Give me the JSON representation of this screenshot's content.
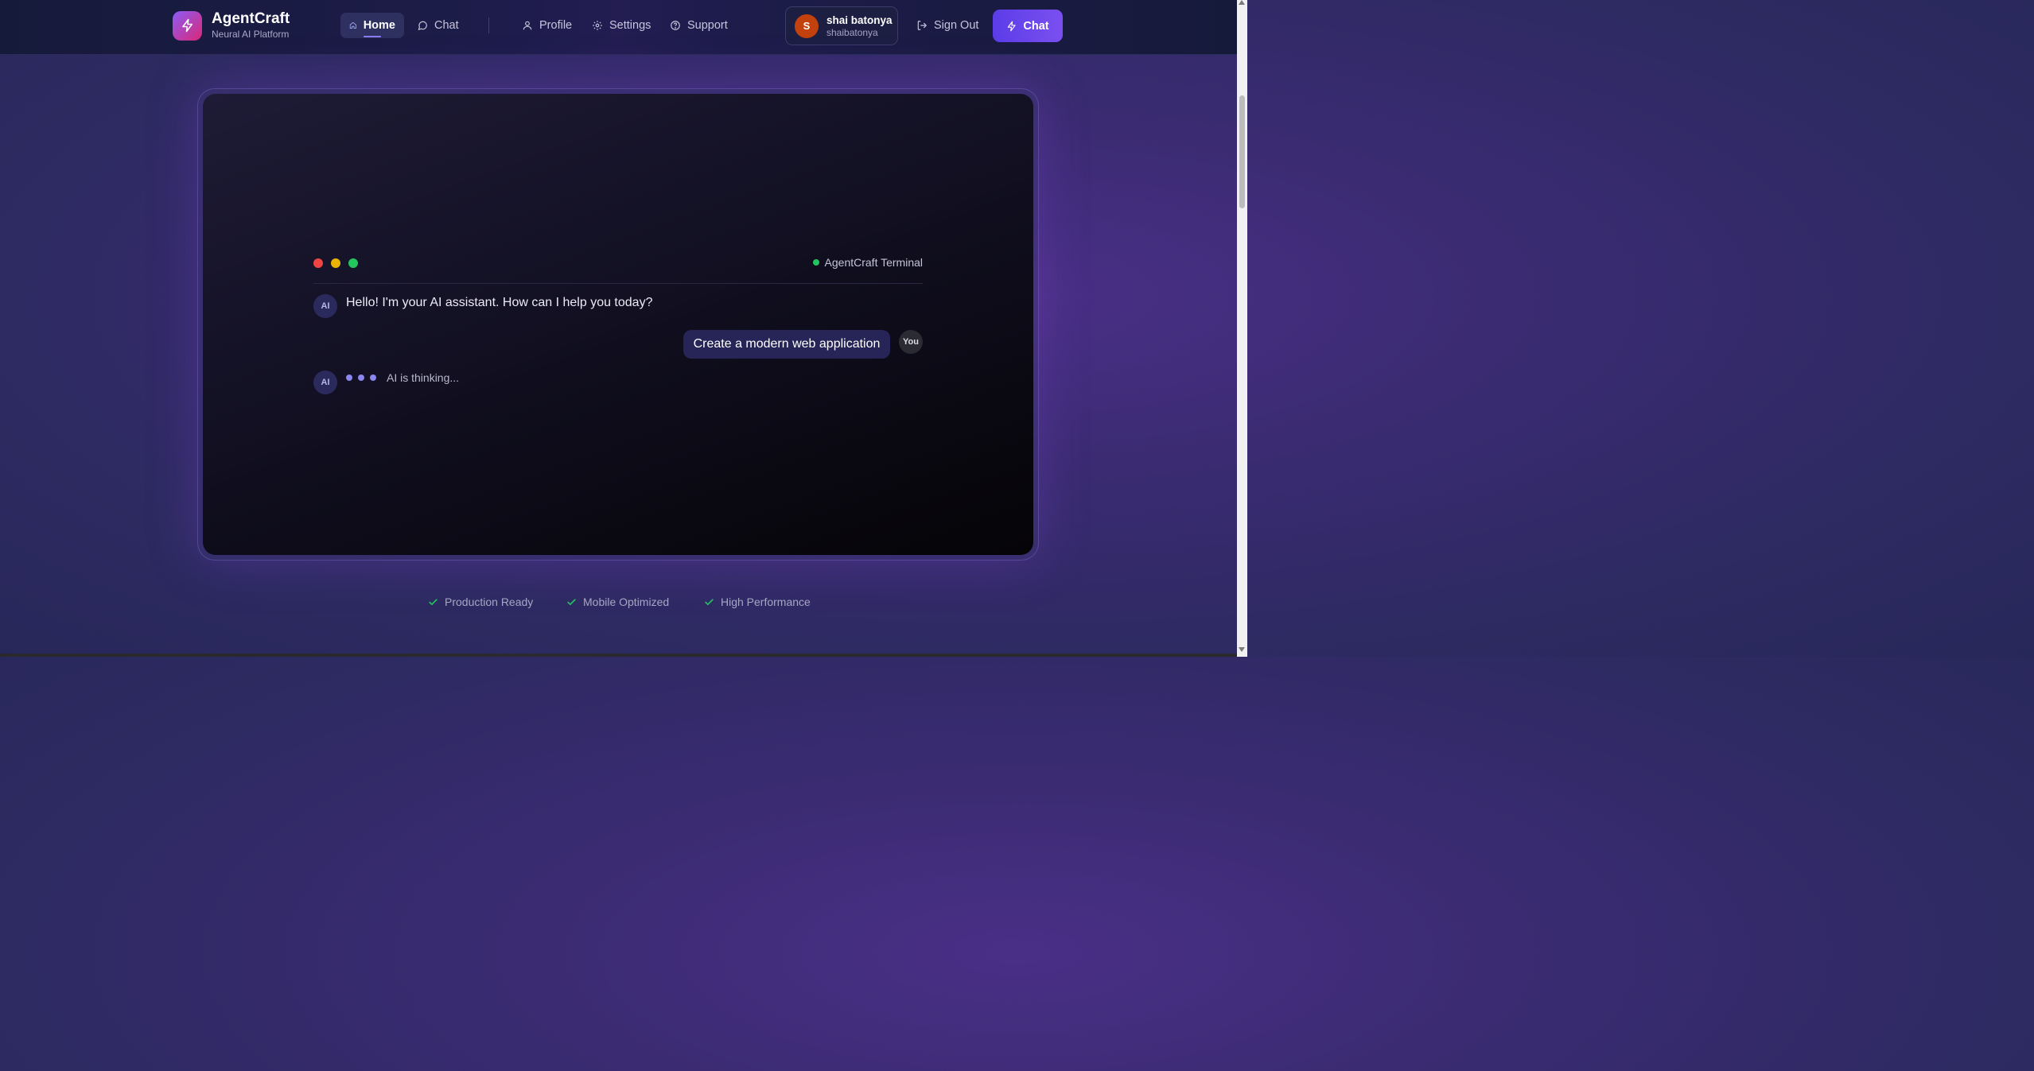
{
  "brand": {
    "title": "AgentCraft",
    "subtitle": "Neural AI Platform",
    "logo_icon": "lightning-icon"
  },
  "nav": {
    "home": "Home",
    "chat": "Chat",
    "profile": "Profile",
    "settings": "Settings",
    "support": "Support"
  },
  "user": {
    "initial": "S",
    "name": "shai batonya",
    "handle": "shaibatonya"
  },
  "actions": {
    "sign_out": "Sign Out",
    "chat_cta": "Chat"
  },
  "terminal": {
    "title": "AgentCraft Terminal",
    "ai_label": "AI",
    "ai_greeting": "Hello! I'm your AI assistant. How can I help you today?",
    "user_label": "You",
    "user_message": "Create a modern web application",
    "thinking": "AI is thinking..."
  },
  "features": [
    "Production Ready",
    "Mobile Optimized",
    "High Performance"
  ],
  "colors": {
    "accent": "#6d4ff0",
    "status_green": "#22c55e",
    "dot_red": "#ef4444",
    "dot_yellow": "#eab308",
    "dot_green": "#22c55e"
  }
}
